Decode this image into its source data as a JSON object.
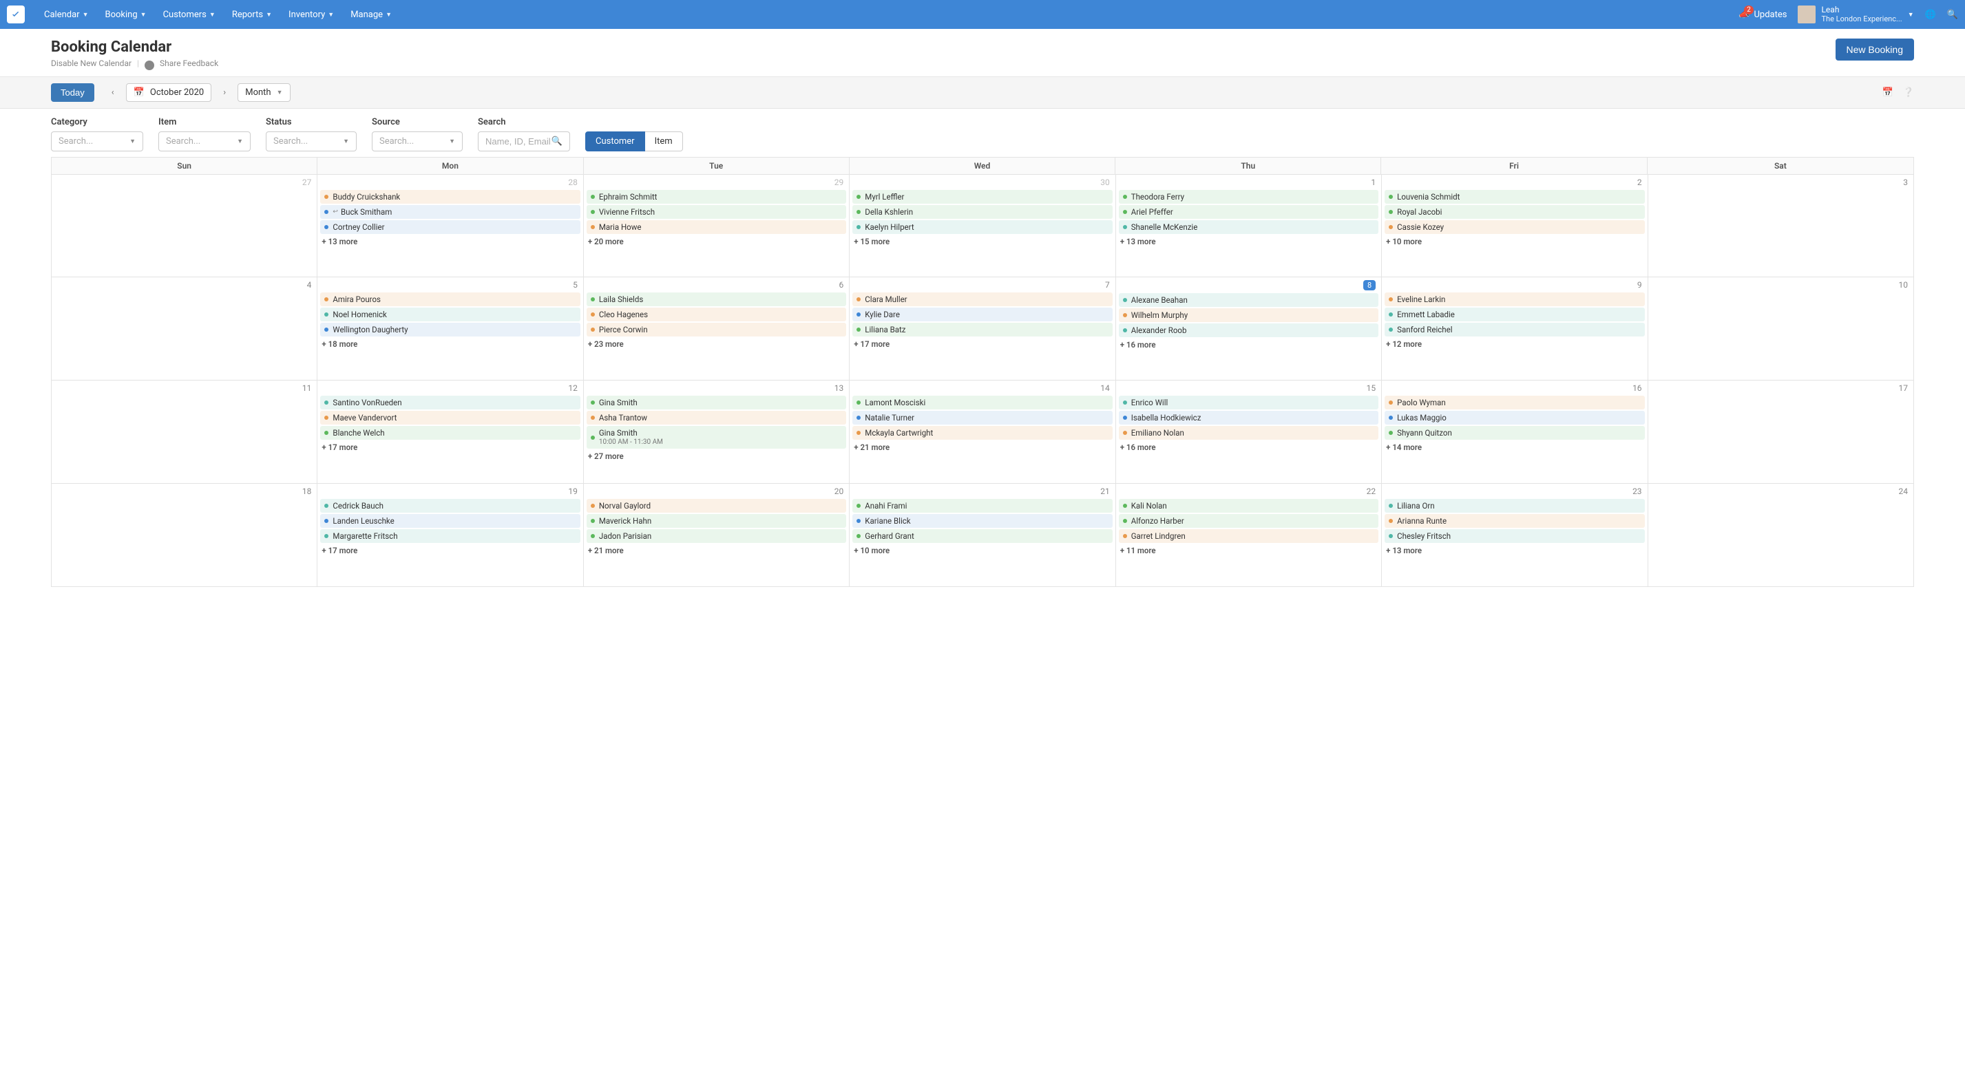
{
  "nav": {
    "items": [
      "Calendar",
      "Booking",
      "Customers",
      "Reports",
      "Inventory",
      "Manage"
    ],
    "updates_label": "Updates",
    "updates_badge": "2",
    "user_name": "Leah",
    "user_org": "The London Experienc..."
  },
  "header": {
    "title": "Booking Calendar",
    "disable_link": "Disable New Calendar",
    "feedback": "Share Feedback",
    "new_booking": "New Booking"
  },
  "toolbar": {
    "today": "Today",
    "date": "October 2020",
    "view": "Month"
  },
  "filters": {
    "category_label": "Category",
    "item_label": "Item",
    "status_label": "Status",
    "source_label": "Source",
    "search_label": "Search",
    "placeholder_search": "Search...",
    "placeholder_name": "Name, ID, Email...",
    "toggle_customer": "Customer",
    "toggle_item": "Item"
  },
  "dow": [
    "Sun",
    "Mon",
    "Tue",
    "Wed",
    "Thu",
    "Fri",
    "Sat"
  ],
  "weeks": [
    [
      {
        "num": "27",
        "out": true,
        "events": [],
        "more": ""
      },
      {
        "num": "28",
        "out": true,
        "events": [
          {
            "c": "orange",
            "t": "Buddy Cruickshank"
          },
          {
            "c": "blue",
            "t": "Buck Smitham",
            "ret": true
          },
          {
            "c": "blue",
            "t": "Cortney Collier"
          }
        ],
        "more": "+ 13 more"
      },
      {
        "num": "29",
        "out": true,
        "events": [
          {
            "c": "green",
            "t": "Ephraim Schmitt"
          },
          {
            "c": "green",
            "t": "Vivienne Fritsch"
          },
          {
            "c": "orange",
            "t": "Maria Howe"
          }
        ],
        "more": "+ 20 more"
      },
      {
        "num": "30",
        "out": true,
        "events": [
          {
            "c": "green",
            "t": "Myrl Leffler"
          },
          {
            "c": "green",
            "t": "Della Kshlerin"
          },
          {
            "c": "teal",
            "t": "Kaelyn Hilpert"
          }
        ],
        "more": "+ 15 more"
      },
      {
        "num": "1",
        "events": [
          {
            "c": "green",
            "t": "Theodora Ferry"
          },
          {
            "c": "green",
            "t": "Ariel Pfeffer"
          },
          {
            "c": "teal",
            "t": "Shanelle McKenzie"
          }
        ],
        "more": "+ 13 more"
      },
      {
        "num": "2",
        "events": [
          {
            "c": "green",
            "t": "Louvenia Schmidt"
          },
          {
            "c": "green",
            "t": "Royal Jacobi"
          },
          {
            "c": "orange",
            "t": "Cassie Kozey"
          }
        ],
        "more": "+ 10 more"
      },
      {
        "num": "3",
        "events": [],
        "more": ""
      }
    ],
    [
      {
        "num": "4",
        "events": [],
        "more": ""
      },
      {
        "num": "5",
        "events": [
          {
            "c": "orange",
            "t": "Amira Pouros"
          },
          {
            "c": "teal",
            "t": "Noel Homenick"
          },
          {
            "c": "blue",
            "t": "Wellington Daugherty"
          }
        ],
        "more": "+ 18 more"
      },
      {
        "num": "6",
        "events": [
          {
            "c": "green",
            "t": "Laila Shields"
          },
          {
            "c": "orange",
            "t": "Cleo Hagenes"
          },
          {
            "c": "orange",
            "t": "Pierce Corwin"
          }
        ],
        "more": "+ 23 more"
      },
      {
        "num": "7",
        "events": [
          {
            "c": "orange",
            "t": "Clara Muller"
          },
          {
            "c": "blue",
            "t": "Kylie Dare"
          },
          {
            "c": "green",
            "t": "Liliana Batz"
          }
        ],
        "more": "+ 17 more"
      },
      {
        "num": "8",
        "today": true,
        "events": [
          {
            "c": "teal",
            "t": "Alexane Beahan"
          },
          {
            "c": "orange",
            "t": "Wilhelm Murphy"
          },
          {
            "c": "teal",
            "t": "Alexander Roob"
          }
        ],
        "more": "+ 16 more"
      },
      {
        "num": "9",
        "events": [
          {
            "c": "orange",
            "t": "Eveline Larkin"
          },
          {
            "c": "teal",
            "t": "Emmett Labadie"
          },
          {
            "c": "teal",
            "t": "Sanford Reichel"
          }
        ],
        "more": "+ 12 more"
      },
      {
        "num": "10",
        "events": [],
        "more": ""
      }
    ],
    [
      {
        "num": "11",
        "events": [],
        "more": ""
      },
      {
        "num": "12",
        "events": [
          {
            "c": "teal",
            "t": "Santino VonRueden"
          },
          {
            "c": "orange",
            "t": "Maeve Vandervort"
          },
          {
            "c": "green",
            "t": "Blanche Welch"
          }
        ],
        "more": "+ 17 more"
      },
      {
        "num": "13",
        "events": [
          {
            "c": "green",
            "t": "Gina Smith"
          },
          {
            "c": "orange",
            "t": "Asha Trantow"
          },
          {
            "c": "green",
            "t": "Gina Smith",
            "sub": "10:00 AM - 11:30 AM"
          }
        ],
        "more": "+ 27 more"
      },
      {
        "num": "14",
        "events": [
          {
            "c": "green",
            "t": "Lamont Mosciski"
          },
          {
            "c": "blue",
            "t": "Natalie Turner"
          },
          {
            "c": "orange",
            "t": "Mckayla Cartwright"
          }
        ],
        "more": "+ 21 more"
      },
      {
        "num": "15",
        "events": [
          {
            "c": "teal",
            "t": "Enrico Will"
          },
          {
            "c": "blue",
            "t": "Isabella Hodkiewicz"
          },
          {
            "c": "orange",
            "t": "Emiliano Nolan"
          }
        ],
        "more": "+ 16 more"
      },
      {
        "num": "16",
        "events": [
          {
            "c": "orange",
            "t": "Paolo Wyman"
          },
          {
            "c": "blue",
            "t": "Lukas Maggio"
          },
          {
            "c": "green",
            "t": "Shyann Quitzon"
          }
        ],
        "more": "+ 14 more"
      },
      {
        "num": "17",
        "events": [],
        "more": ""
      }
    ],
    [
      {
        "num": "18",
        "events": [],
        "more": ""
      },
      {
        "num": "19",
        "events": [
          {
            "c": "teal",
            "t": "Cedrick Bauch"
          },
          {
            "c": "blue",
            "t": "Landen Leuschke"
          },
          {
            "c": "teal",
            "t": "Margarette Fritsch"
          }
        ],
        "more": "+ 17 more"
      },
      {
        "num": "20",
        "events": [
          {
            "c": "orange",
            "t": "Norval Gaylord"
          },
          {
            "c": "green",
            "t": "Maverick Hahn"
          },
          {
            "c": "green",
            "t": "Jadon Parisian"
          }
        ],
        "more": "+ 21 more"
      },
      {
        "num": "21",
        "events": [
          {
            "c": "green",
            "t": "Anahi Frami"
          },
          {
            "c": "blue",
            "t": "Kariane Blick"
          },
          {
            "c": "green",
            "t": "Gerhard Grant"
          }
        ],
        "more": "+ 10 more"
      },
      {
        "num": "22",
        "events": [
          {
            "c": "green",
            "t": "Kali Nolan"
          },
          {
            "c": "green",
            "t": "Alfonzo Harber"
          },
          {
            "c": "orange",
            "t": "Garret Lindgren"
          }
        ],
        "more": "+ 11 more"
      },
      {
        "num": "23",
        "events": [
          {
            "c": "teal",
            "t": "Liliana Orn"
          },
          {
            "c": "orange",
            "t": "Arianna Runte"
          },
          {
            "c": "teal",
            "t": "Chesley Fritsch"
          }
        ],
        "more": "+ 13 more"
      },
      {
        "num": "24",
        "events": [],
        "more": ""
      }
    ]
  ]
}
